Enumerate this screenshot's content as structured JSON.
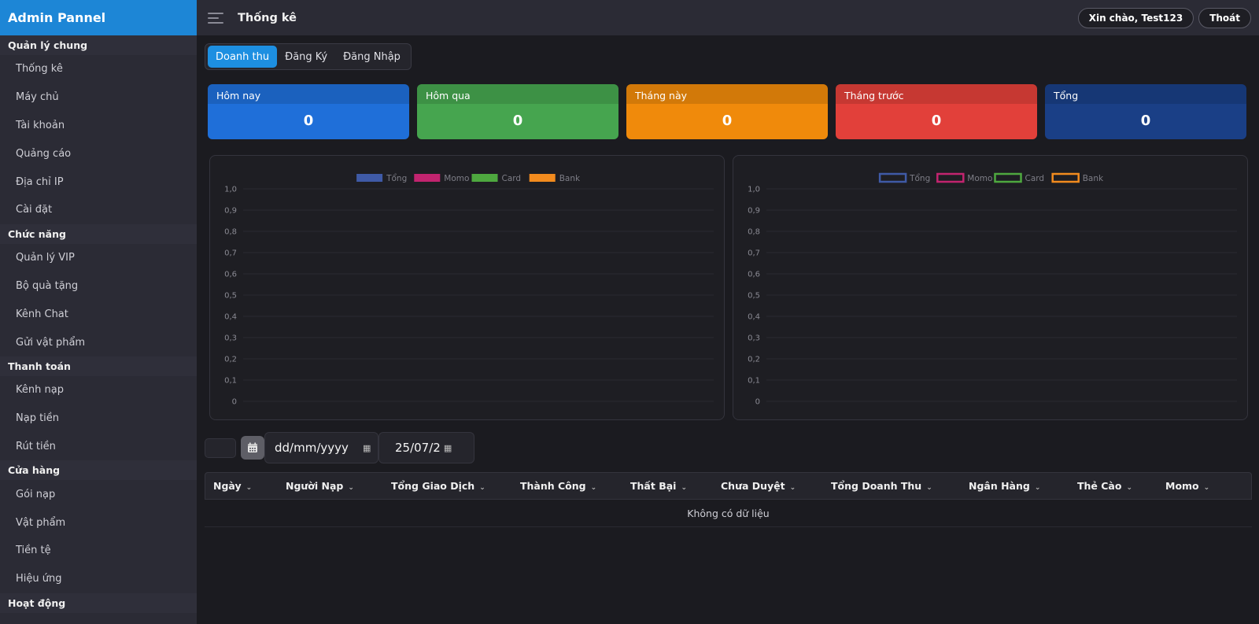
{
  "sidebar": {
    "brand": "Admin Pannel",
    "sections": [
      {
        "title": "Quản lý chung",
        "items": [
          "Thống kê",
          "Máy chủ",
          "Tài khoản",
          "Quảng cáo",
          "Địa chỉ IP",
          "Cài đặt"
        ]
      },
      {
        "title": "Chức năng",
        "items": [
          "Quản lý VIP",
          "Bộ quà tặng",
          "Kênh Chat",
          "Gửi vật phẩm"
        ]
      },
      {
        "title": "Thanh toán",
        "items": [
          "Kênh nạp",
          "Nạp tiền",
          "Rút tiền"
        ]
      },
      {
        "title": "Cửa hàng",
        "items": [
          "Gói nạp",
          "Vật phẩm",
          "Tiền tệ",
          "Hiệu ứng"
        ]
      },
      {
        "title": "Hoạt động",
        "items": []
      }
    ]
  },
  "header": {
    "title": "Thống kê",
    "greeting": "Xin chào, Test123",
    "logout": "Thoát"
  },
  "tabs": [
    "Doanh thu",
    "Đăng Ký",
    "Đăng Nhập"
  ],
  "cards": [
    {
      "label": "Hôm nay",
      "value": "0",
      "color": "#1f6fd9"
    },
    {
      "label": "Hôm qua",
      "value": "0",
      "color": "#46a54f"
    },
    {
      "label": "Tháng này",
      "value": "0",
      "color": "#f08a0b"
    },
    {
      "label": "Tháng trước",
      "value": "0",
      "color": "#e2403a"
    },
    {
      "label": "Tổng",
      "value": "0",
      "color": "#1a3f86"
    }
  ],
  "chart_data": [
    {
      "type": "bar",
      "categories": [],
      "series": [
        {
          "name": "Tổng",
          "values": [],
          "color": "#3f5aa6"
        },
        {
          "name": "Momo",
          "values": [],
          "color": "#c2246f"
        },
        {
          "name": "Card",
          "values": [],
          "color": "#4ea83f"
        },
        {
          "name": "Bank",
          "values": [],
          "color": "#f28b1e"
        }
      ],
      "yticks": [
        "1,0",
        "0,9",
        "0,8",
        "0,7",
        "0,6",
        "0,5",
        "0,4",
        "0,3",
        "0,2",
        "0,1",
        "0"
      ],
      "ylim": [
        0,
        1
      ],
      "legend": "top-center",
      "grid": true
    },
    {
      "type": "line",
      "categories": [],
      "series": [
        {
          "name": "Tổng",
          "values": [],
          "color": "#3f5aa6"
        },
        {
          "name": "Momo",
          "values": [],
          "color": "#c2246f"
        },
        {
          "name": "Card",
          "values": [],
          "color": "#4ea83f"
        },
        {
          "name": "Bank",
          "values": [],
          "color": "#f28b1e"
        }
      ],
      "yticks": [
        "1,0",
        "0,9",
        "0,8",
        "0,7",
        "0,6",
        "0,5",
        "0,4",
        "0,3",
        "0,2",
        "0,1",
        "0"
      ],
      "ylim": [
        0,
        1
      ],
      "legend": "top-center",
      "grid": true
    }
  ],
  "filters": {
    "date_from_placeholder": "dd/mm/yyyy",
    "date_to_value": "25/07/2"
  },
  "table": {
    "columns": [
      "Ngày",
      "Người Nạp",
      "Tổng Giao Dịch",
      "Thành Công",
      "Thất Bại",
      "Chưa Duyệt",
      "Tổng Doanh Thu",
      "Ngân Hàng",
      "Thẻ Cào",
      "Momo"
    ],
    "rows": [],
    "empty_text": "Không có dữ liệu"
  }
}
